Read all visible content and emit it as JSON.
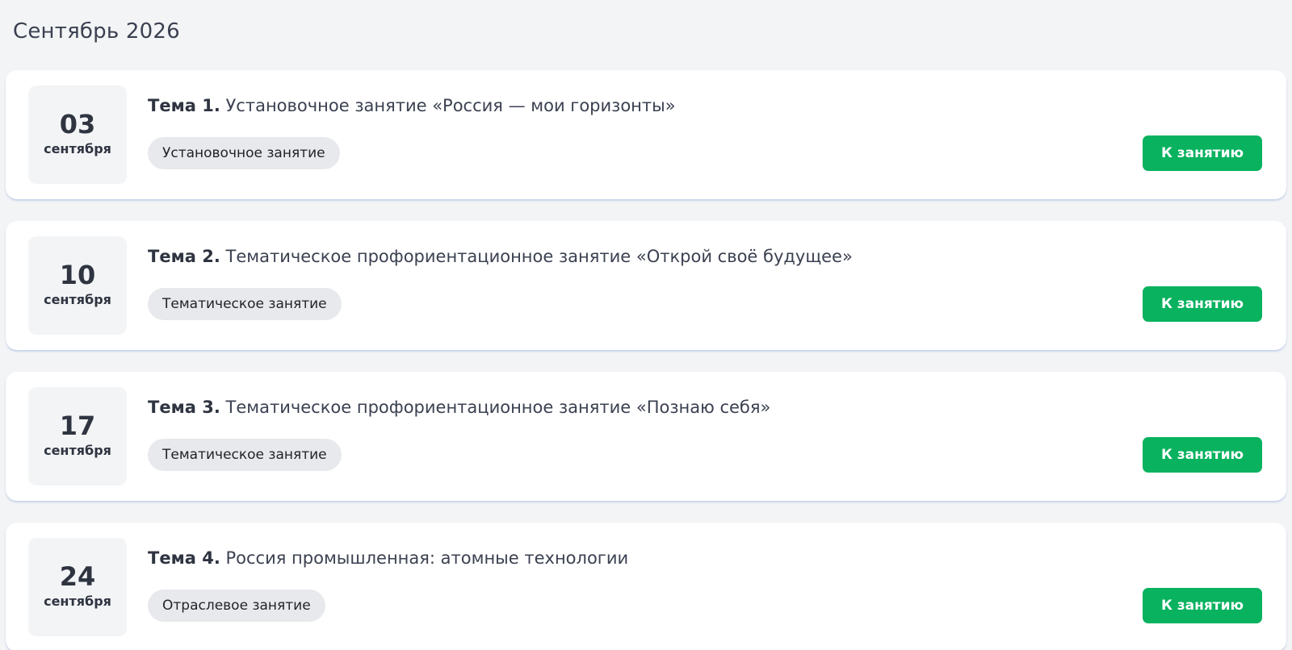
{
  "month_title": "Сентябрь 2026",
  "lessons": [
    {
      "day": "03",
      "month": "сентября",
      "topic_label": "Тема 1.",
      "title": "Установочное занятие «Россия — мои горизонты»",
      "tag": "Установочное занятие",
      "button_label": "К занятию"
    },
    {
      "day": "10",
      "month": "сентября",
      "topic_label": "Тема 2.",
      "title": "Тематическое профориентационное занятие «Открой своё будущее»",
      "tag": "Тематическое занятие",
      "button_label": "К занятию"
    },
    {
      "day": "17",
      "month": "сентября",
      "topic_label": "Тема 3.",
      "title": "Тематическое профориентационное занятие «Познаю себя»",
      "tag": "Тематическое занятие",
      "button_label": "К занятию"
    },
    {
      "day": "24",
      "month": "сентября",
      "topic_label": "Тема 4.",
      "title": "Россия промышленная: атомные технологии",
      "tag": "Отраслевое занятие",
      "button_label": "К занятию"
    }
  ],
  "colors": {
    "background": "#f3f4f6",
    "card": "#ffffff",
    "accent_button": "#08b25f",
    "tag_background": "#e8e9ec",
    "text_primary": "#2f3441"
  }
}
